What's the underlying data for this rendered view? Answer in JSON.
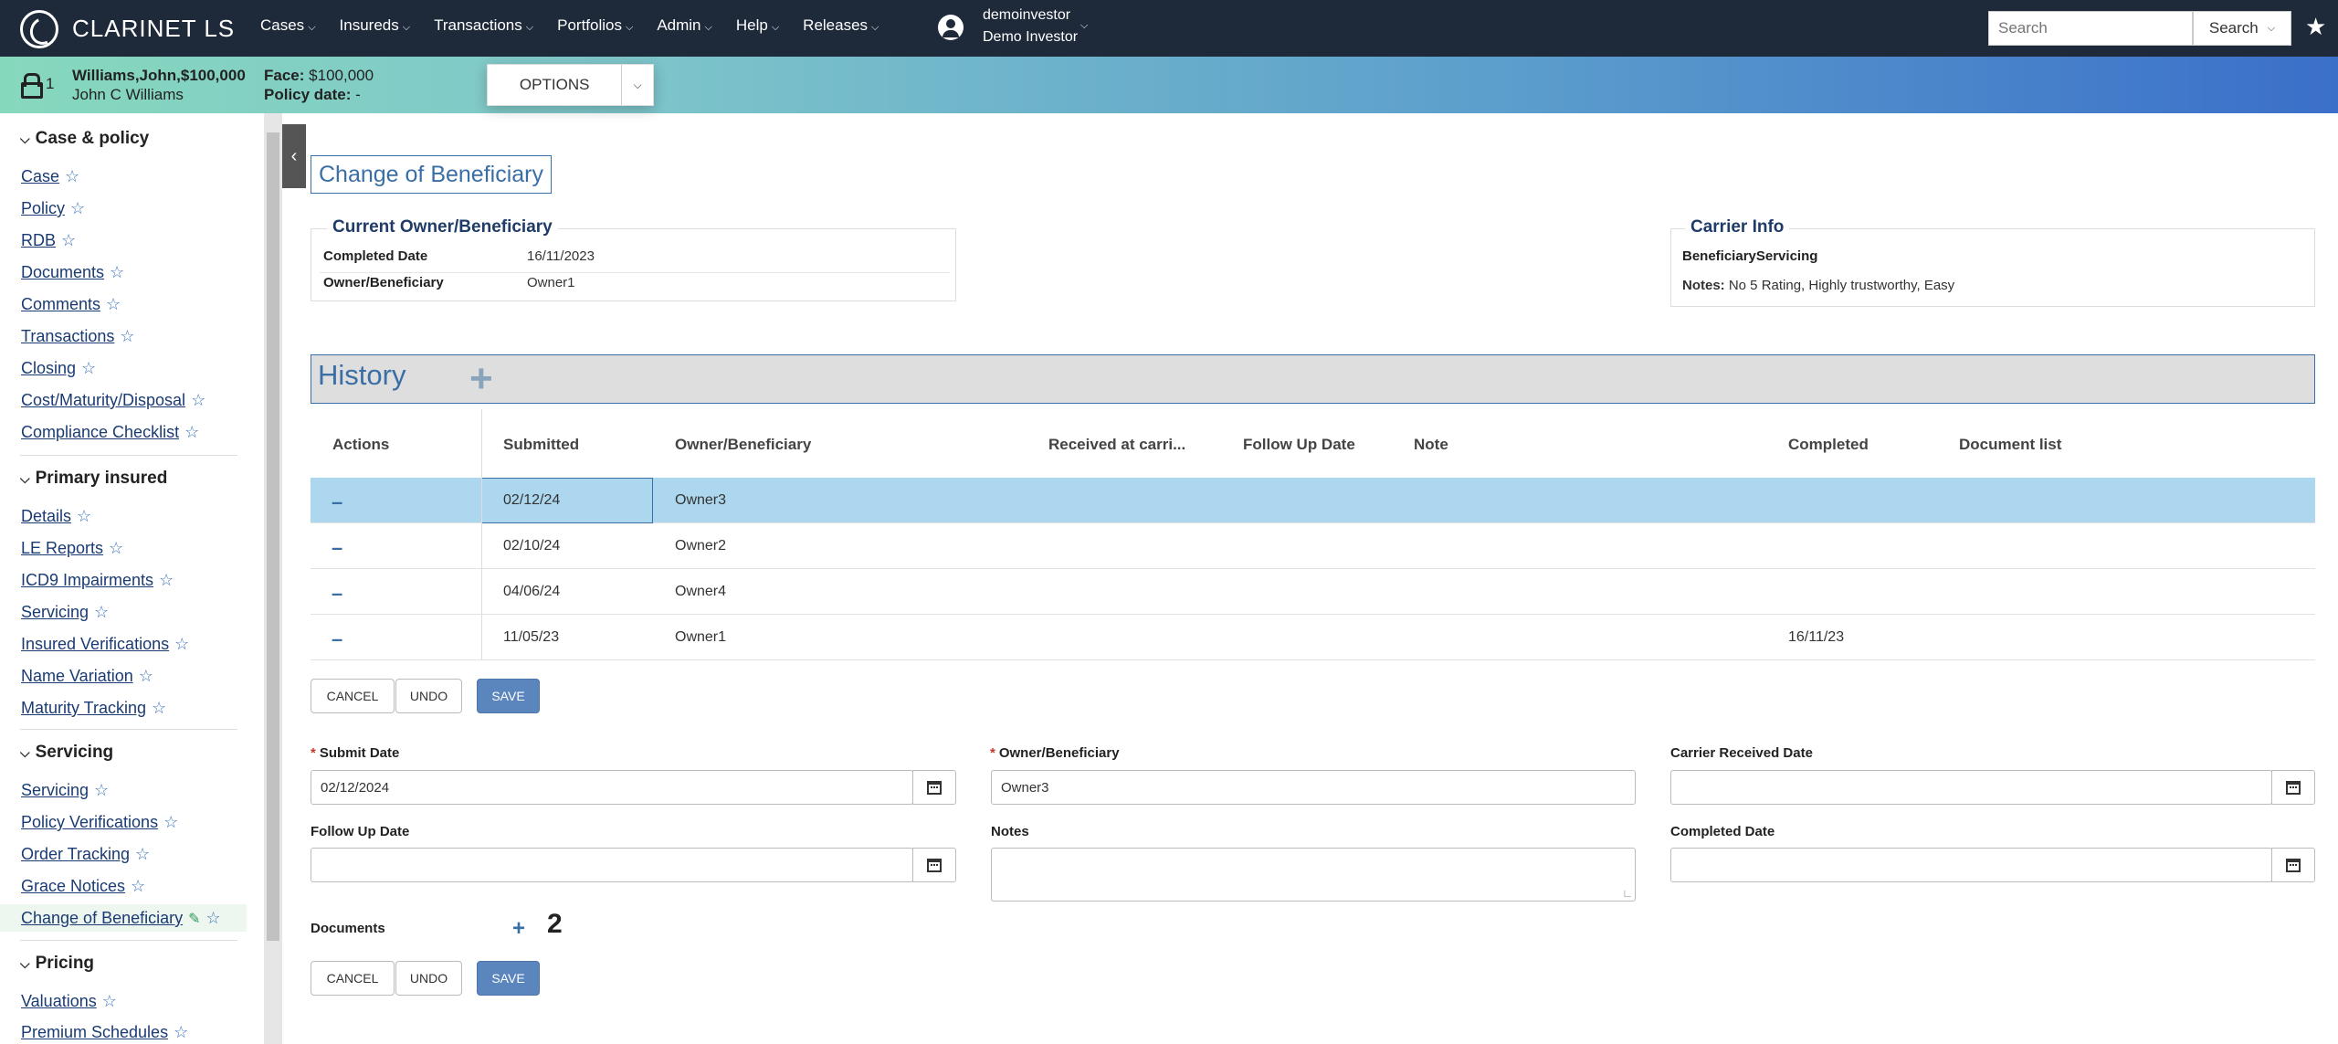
{
  "app": {
    "name": "CLARINET LS"
  },
  "nav": {
    "items": [
      "Cases",
      "Insureds",
      "Transactions",
      "Portfolios",
      "Admin",
      "Help",
      "Releases"
    ],
    "user": {
      "name": "demoinvestor",
      "role": "Demo Investor"
    },
    "search": {
      "placeholder": "Search",
      "button": "Search"
    }
  },
  "banner": {
    "count": "1",
    "case": "Williams,John,$100,000",
    "insured": "John C Williams",
    "face_label": "Face:",
    "face_value": "$100,000",
    "policy_date_label": "Policy date:",
    "policy_date_value": "-",
    "options": "OPTIONS"
  },
  "sidebar": {
    "sections": [
      {
        "title": "Case & policy",
        "items": [
          "Case",
          "Policy",
          "RDB",
          "Documents",
          "Comments",
          "Transactions",
          "Closing",
          "Cost/Maturity/Disposal",
          "Compliance Checklist"
        ]
      },
      {
        "title": "Primary insured",
        "items": [
          "Details",
          "LE Reports",
          "ICD9 Impairments",
          "Servicing",
          "Insured Verifications",
          "Name Variation",
          "Maturity Tracking"
        ]
      },
      {
        "title": "Servicing",
        "items": [
          "Servicing",
          "Policy Verifications",
          "Order Tracking",
          "Grace Notices",
          "Change of Beneficiary"
        ]
      },
      {
        "title": "Pricing",
        "items": [
          "Valuations",
          "Premium Schedules"
        ]
      }
    ]
  },
  "page": {
    "title": "Change of Beneficiary"
  },
  "current": {
    "title": "Current Owner/Beneficiary",
    "completed_label": "Completed Date",
    "completed_value": "16/11/2023",
    "owner_label": "Owner/Beneficiary",
    "owner_value": "Owner1"
  },
  "carrier": {
    "title": "Carrier Info",
    "name": "BeneficiaryServicing",
    "notes_label": "Notes:",
    "notes_value": "No 5 Rating, Highly trustworthy, Easy"
  },
  "history": {
    "title": "History",
    "columns": [
      "Actions",
      "Submitted",
      "Owner/Beneficiary",
      "Received at carri...",
      "Follow Up Date",
      "Note",
      "Completed",
      "Document list"
    ],
    "rows": [
      {
        "submitted": "02/12/24",
        "owner": "Owner3",
        "completed": ""
      },
      {
        "submitted": "02/10/24",
        "owner": "Owner2",
        "completed": ""
      },
      {
        "submitted": "04/06/24",
        "owner": "Owner4",
        "completed": ""
      },
      {
        "submitted": "11/05/23",
        "owner": "Owner1",
        "completed": "16/11/23"
      }
    ]
  },
  "buttons": {
    "cancel": "CANCEL",
    "undo": "UNDO",
    "save": "SAVE"
  },
  "form": {
    "submit_date_label": "Submit Date",
    "submit_date_value": "02/12/2024",
    "owner_label": "Owner/Beneficiary",
    "owner_value": "Owner3",
    "carrier_received_label": "Carrier Received Date",
    "carrier_received_value": "",
    "follow_up_label": "Follow Up Date",
    "follow_up_value": "",
    "notes_label": "Notes",
    "notes_value": "",
    "completed_label": "Completed Date",
    "completed_value": "",
    "documents_label": "Documents",
    "documents_count": "2"
  }
}
